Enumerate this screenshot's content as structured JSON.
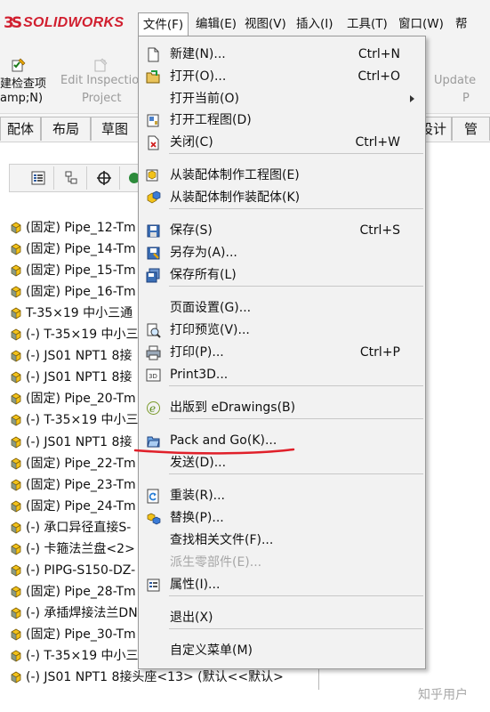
{
  "app": {
    "logo_text": "SOLIDWORKS",
    "logo_mark": "3S"
  },
  "menubar": {
    "file": "文件(F)",
    "edit": "编辑(E)",
    "view": "视图(V)",
    "insert": "插入(I)",
    "tools": "工具(T)",
    "window": "窗口(W)",
    "help": "帮"
  },
  "ribbon": {
    "check": "建检查项",
    "amp": "amp;N)",
    "edit_inspection": "Edit Inspection",
    "project": "Project",
    "update": "Update",
    "p": "P"
  },
  "tabs": {
    "assembly": "配体",
    "layout": "布局",
    "sketch": "草图",
    "design": "设计",
    "tube": "管"
  },
  "tree_items": [
    "(固定) Pipe_12-Tm",
    "(固定) Pipe_14-Tm",
    "(固定) Pipe_15-Tm",
    "(固定) Pipe_16-Tm",
    "T-35×19 中小三通",
    "(-) T-35×19 中小三",
    "(-) JS01 NPT1 8接",
    "(-) JS01 NPT1 8接",
    "(固定) Pipe_20-Tm",
    "(-) T-35×19 中小三",
    "(-) JS01 NPT1 8接",
    "(固定) Pipe_22-Tm",
    "(固定) Pipe_23-Tm",
    "(固定) Pipe_24-Tm",
    "(-) 承口异径直接S-",
    "(-) 卡箍法兰盘<2>",
    "(-) PIPG-S150-DZ-",
    "(固定) Pipe_28-Tm",
    "(-) 承插焊接法兰DN",
    "(固定) Pipe_30-Tm",
    "(-) T-35×19 中小三",
    "(-) JS01 NPT1 8接头座<13> (默认<<默认>"
  ],
  "file_menu": {
    "items": [
      {
        "label": "新建(N)...",
        "shortcut": "Ctrl+N",
        "icon": "new-document-icon"
      },
      {
        "label": "打开(O)...",
        "shortcut": "Ctrl+O",
        "icon": "open-folder-icon"
      },
      {
        "label": "打开当前(O)",
        "shortcut": "",
        "icon": "",
        "submenu": true
      },
      {
        "label": "打开工程图(D)",
        "shortcut": "",
        "icon": "open-drawing-icon"
      },
      {
        "label": "关闭(C)",
        "shortcut": "Ctrl+W",
        "icon": "close-document-icon"
      },
      {
        "label": "从装配体制作工程图(E)",
        "shortcut": "",
        "icon": "make-drawing-icon"
      },
      {
        "label": "从装配体制作装配体(K)",
        "shortcut": "",
        "icon": "make-assembly-icon"
      },
      {
        "label": "保存(S)",
        "shortcut": "Ctrl+S",
        "icon": "save-icon"
      },
      {
        "label": "另存为(A)...",
        "shortcut": "",
        "icon": "save-as-icon"
      },
      {
        "label": "保存所有(L)",
        "shortcut": "",
        "icon": "save-all-icon"
      },
      {
        "label": "页面设置(G)...",
        "shortcut": "",
        "icon": ""
      },
      {
        "label": "打印预览(V)...",
        "shortcut": "",
        "icon": "print-preview-icon"
      },
      {
        "label": "打印(P)...",
        "shortcut": "Ctrl+P",
        "icon": "print-icon"
      },
      {
        "label": "Print3D...",
        "shortcut": "",
        "icon": "print3d-icon"
      },
      {
        "label": "出版到 eDrawings(B)",
        "shortcut": "",
        "icon": "edrawings-icon"
      },
      {
        "label": "Pack and Go(K)...",
        "shortcut": "",
        "icon": "pack-and-go-icon"
      },
      {
        "label": "发送(D)...",
        "shortcut": "",
        "icon": ""
      },
      {
        "label": "重装(R)...",
        "shortcut": "",
        "icon": "reload-icon"
      },
      {
        "label": "替换(P)...",
        "shortcut": "",
        "icon": "replace-icon"
      },
      {
        "label": "查找相关文件(F)...",
        "shortcut": "",
        "icon": ""
      },
      {
        "label": "派生零部件(E)...",
        "shortcut": "",
        "icon": "",
        "disabled": true
      },
      {
        "label": "属性(I)...",
        "shortcut": "",
        "icon": "properties-icon"
      },
      {
        "label": "退出(X)",
        "shortcut": "",
        "icon": ""
      },
      {
        "label": "自定义菜单(M)",
        "shortcut": "",
        "icon": ""
      }
    ]
  },
  "watermark": "知乎用户",
  "colors": {
    "brand_red": "#d11f2f",
    "annotation_red": "#e0202a",
    "menu_bg": "#f2f2f2"
  }
}
